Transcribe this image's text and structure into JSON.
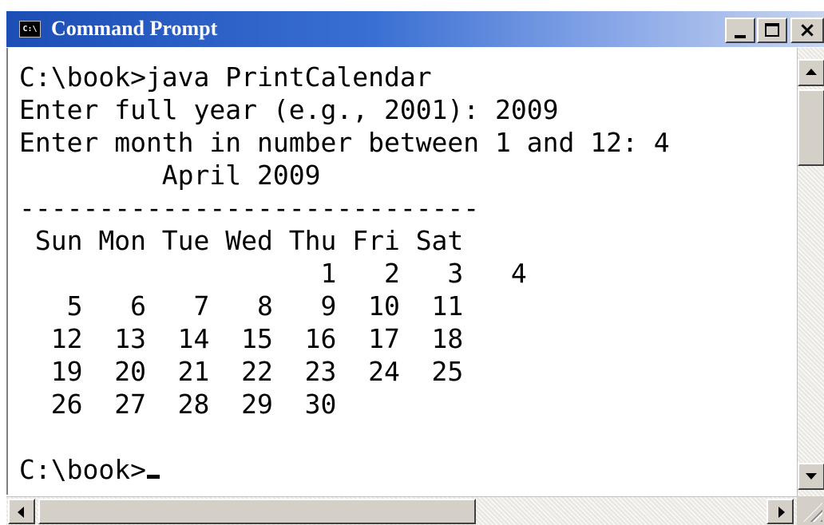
{
  "window": {
    "title": "Command Prompt",
    "icon": "cmd-icon",
    "icon_text": "C:\\",
    "controls": {
      "minimize": "minimize-icon",
      "maximize": "maximize-icon",
      "close_label": "×"
    }
  },
  "console": {
    "prompt_command": "C:\\book>java PrintCalendar",
    "line_year": "Enter full year (e.g., 2001): 2009",
    "line_month": "Enter month in number between 1 and 12: 4",
    "calendar_title": "         April 2009",
    "separator": "-----------------------------",
    "weekday_header": " Sun Mon Tue Wed Thu Fri Sat",
    "week_rows": [
      "                   1   2   3   4",
      "   5   6   7   8   9  10  11",
      "  12  13  14  15  16  17  18",
      "  19  20  21  22  23  24  25",
      "  26  27  28  29  30"
    ],
    "blank_line": "",
    "final_prompt": "C:\\book>"
  },
  "scrollbars": {
    "vertical": {
      "position": 0.0
    },
    "horizontal": {
      "position": 0.0
    }
  },
  "colors": {
    "titlebar_start": "#1c4eb6",
    "titlebar_end": "#c8d5ef",
    "console_bg": "#ffffff",
    "console_text": "#000000",
    "chrome": "#d4d0c8"
  }
}
